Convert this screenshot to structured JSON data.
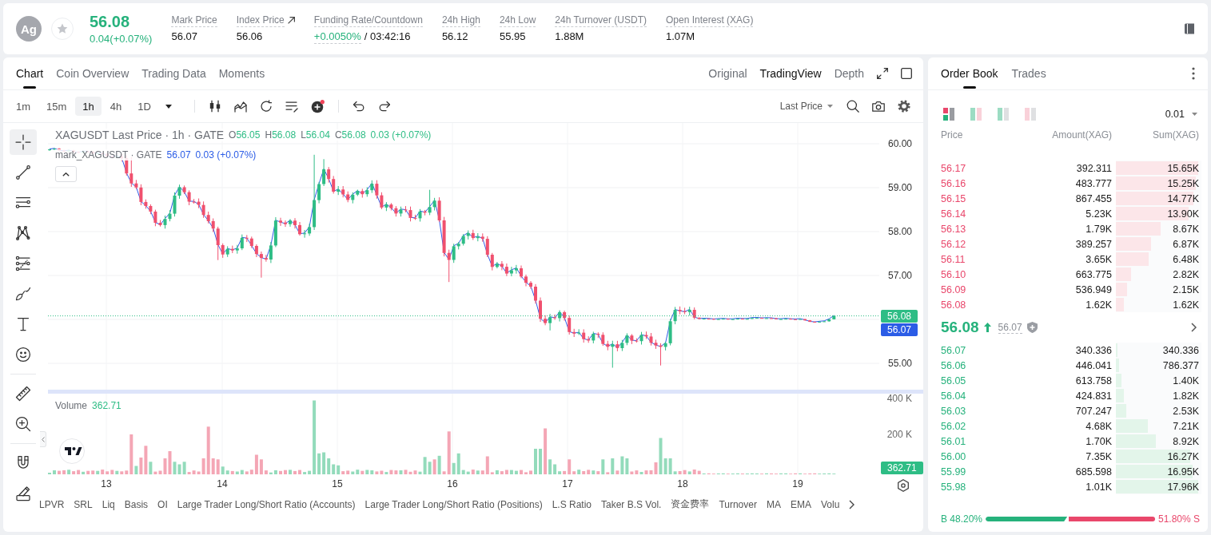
{
  "header": {
    "coin": "Ag",
    "favorited": false,
    "last_price": "56.08",
    "change": "0.04(+0.07%)",
    "stats": [
      {
        "kind": "plain",
        "label": "Mark Price",
        "value": "56.07"
      },
      {
        "kind": "link",
        "label": "Index Price",
        "value": "56.06"
      },
      {
        "kind": "funding",
        "label": "Funding Rate/Countdown",
        "value": "+0.0050%",
        "countdown": "/ 03:42:16"
      },
      {
        "kind": "plain",
        "label": "24h High",
        "value": "56.12"
      },
      {
        "kind": "plain",
        "label": "24h Low",
        "value": "55.95"
      },
      {
        "kind": "plain",
        "label": "24h Turnover (USDT)",
        "value": "1.88M"
      },
      {
        "kind": "plain",
        "label": "Open Interest (XAG)",
        "value": "1.07M"
      }
    ]
  },
  "chart_panel": {
    "tabs": [
      {
        "label": "Chart",
        "selected": true
      },
      {
        "label": "Coin Overview",
        "selected": false
      },
      {
        "label": "Trading Data",
        "selected": false
      },
      {
        "label": "Moments",
        "selected": false
      }
    ],
    "views": [
      {
        "label": "Original",
        "selected": false
      },
      {
        "label": "TradingView",
        "selected": true
      },
      {
        "label": "Depth",
        "selected": false
      }
    ],
    "intervals": [
      {
        "label": "1m",
        "selected": false
      },
      {
        "label": "15m",
        "selected": false
      },
      {
        "label": "1h",
        "selected": true
      },
      {
        "label": "4h",
        "selected": false
      },
      {
        "label": "1D",
        "selected": false
      }
    ],
    "price_source": "Last Price",
    "drawing_tools": [
      [
        {
          "kind": "crosshair",
          "selected": true
        },
        {
          "kind": "trendline",
          "selected": false
        },
        {
          "kind": "channel",
          "selected": false
        },
        {
          "kind": "pattern",
          "selected": false
        },
        {
          "kind": "fibonacci",
          "selected": false
        },
        {
          "kind": "brush",
          "selected": false
        },
        {
          "kind": "text",
          "selected": false
        },
        {
          "kind": "emoji",
          "selected": false
        }
      ],
      [
        {
          "kind": "ruler",
          "selected": false
        },
        {
          "kind": "zoom",
          "selected": false
        }
      ],
      [
        {
          "kind": "magnet",
          "selected": false
        },
        {
          "kind": "lock",
          "selected": false
        }
      ]
    ],
    "legend": {
      "title": "XAGUSDT Last Price · 1h · GATE",
      "ohlc": [
        {
          "label": "O",
          "value": "56.05"
        },
        {
          "label": "H",
          "value": "56.08"
        },
        {
          "label": "L",
          "value": "56.04"
        },
        {
          "label": "C",
          "value": "56.08"
        }
      ],
      "change": "0.03 (+0.07%)"
    },
    "mark_legend": {
      "title": "mark_XAGUSDT · GATE",
      "value": "56.07",
      "change": "0.03 (+0.07%)"
    },
    "price_axis": [
      "60.00",
      "59.00",
      "58.00",
      "57.00",
      "55.00"
    ],
    "last_price_tag": "56.08",
    "mark_price_tag": "56.07",
    "volume": {
      "label": "Volume",
      "value": "362.71",
      "axis": [
        "400 K",
        "200 K"
      ],
      "tag": "362.71"
    },
    "time_axis": [
      "13",
      "14",
      "15",
      "16",
      "17",
      "18",
      "19"
    ],
    "indicators": [
      "LPVR",
      "SRL",
      "Liq",
      "Basis",
      "OI",
      "Large Trader Long/Short Ratio (Accounts)",
      "Large Trader Long/Short Ratio (Positions)",
      "L.S Ratio",
      "Taker B.S Vol.",
      "资金费率",
      "Turnover",
      "MA",
      "EMA",
      "Volu"
    ]
  },
  "order_book": {
    "tabs": [
      {
        "label": "Order Book",
        "selected": true
      },
      {
        "label": "Trades",
        "selected": false
      }
    ],
    "layouts": [
      {
        "kind": "both",
        "selected": true
      },
      {
        "kind": "mixed",
        "selected": false
      },
      {
        "kind": "bids",
        "selected": false
      },
      {
        "kind": "asks",
        "selected": false
      }
    ],
    "precision": "0.01",
    "columns": [
      "Price",
      "Amount(XAG)",
      "Sum(XAG)"
    ],
    "asks": [
      {
        "price": "56.17",
        "amount": "392.311",
        "sum": "15.65K",
        "level": 1.0
      },
      {
        "price": "56.16",
        "amount": "483.777",
        "sum": "15.25K",
        "level": 0.97
      },
      {
        "price": "56.15",
        "amount": "867.455",
        "sum": "14.77K",
        "level": 0.94
      },
      {
        "price": "56.14",
        "amount": "5.23K",
        "sum": "13.90K",
        "level": 0.88
      },
      {
        "price": "56.13",
        "amount": "1.79K",
        "sum": "8.67K",
        "level": 0.54
      },
      {
        "price": "56.12",
        "amount": "389.257",
        "sum": "6.87K",
        "level": 0.43
      },
      {
        "price": "56.11",
        "amount": "3.65K",
        "sum": "6.48K",
        "level": 0.4
      },
      {
        "price": "56.10",
        "amount": "663.775",
        "sum": "2.82K",
        "level": 0.18
      },
      {
        "price": "56.09",
        "amount": "536.949",
        "sum": "2.15K",
        "level": 0.14
      },
      {
        "price": "56.08",
        "amount": "1.62K",
        "sum": "1.62K",
        "level": 0.1
      }
    ],
    "mid": {
      "price": "56.08",
      "rising": true,
      "mark_price": "56.07"
    },
    "bids": [
      {
        "price": "56.07",
        "amount": "340.336",
        "sum": "340.336",
        "level": 0.02
      },
      {
        "price": "56.06",
        "amount": "446.041",
        "sum": "786.377",
        "level": 0.04
      },
      {
        "price": "56.05",
        "amount": "613.758",
        "sum": "1.40K",
        "level": 0.07
      },
      {
        "price": "56.04",
        "amount": "424.831",
        "sum": "1.82K",
        "level": 0.1
      },
      {
        "price": "56.03",
        "amount": "707.247",
        "sum": "2.53K",
        "level": 0.13
      },
      {
        "price": "56.02",
        "amount": "4.68K",
        "sum": "7.21K",
        "level": 0.39
      },
      {
        "price": "56.01",
        "amount": "1.70K",
        "sum": "8.92K",
        "level": 0.49
      },
      {
        "price": "56.00",
        "amount": "7.35K",
        "sum": "16.27K",
        "level": 0.9
      },
      {
        "price": "55.99",
        "amount": "685.598",
        "sum": "16.95K",
        "level": 0.93
      },
      {
        "price": "55.98",
        "amount": "1.01K",
        "sum": "17.96K",
        "level": 1.0
      }
    ],
    "ratio": {
      "buy": "B 48.20%",
      "sell": "51.80% S",
      "level": 0.482
    }
  }
}
